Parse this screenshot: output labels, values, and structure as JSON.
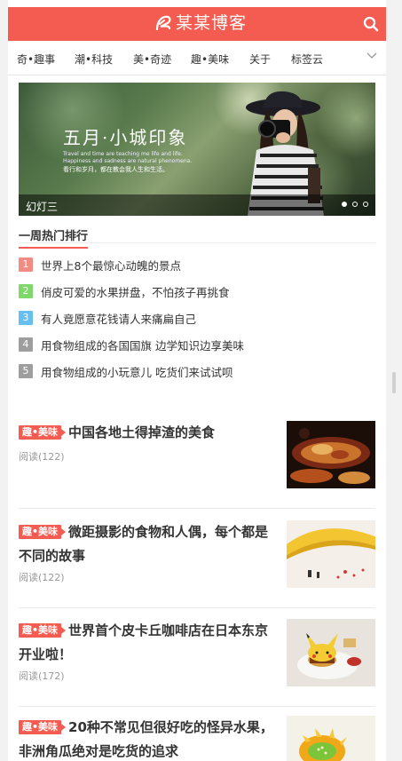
{
  "header": {
    "site_name": "某某博客",
    "brand_color": "#f45c52"
  },
  "nav": {
    "items": [
      "奇•趣事",
      "潮•科技",
      "美•奇迹",
      "趣•美味",
      "关于",
      "标签云"
    ]
  },
  "slider": {
    "headline": "五月·小城印象",
    "sub1": "Travel and time are teaching me life and life.",
    "sub2": "Happiness and sadness are natural phenomena.",
    "sub3": "看行和岁月，都在教会我人生和生活。",
    "caption": "幻灯三",
    "slides_total": 3,
    "active_slide": 1
  },
  "hot": {
    "title": "一周热门排行",
    "items": [
      {
        "rank": "1",
        "text": "世界上8个最惊心动魄的景点",
        "color": "#f28b82"
      },
      {
        "rank": "2",
        "text": "俏皮可爱的水果拼盘，不怕孩子再挑食",
        "color": "#7ed86a"
      },
      {
        "rank": "3",
        "text": "有人竟愿意花钱请人来痛扁自己",
        "color": "#66bff0"
      },
      {
        "rank": "4",
        "text": "用食物组成的各国国旗 边学知识边享美味",
        "color": "#9e9e9e"
      },
      {
        "rank": "5",
        "text": "用食物组成的小玩意儿 吃货们来试试呗",
        "color": "#9e9e9e"
      }
    ]
  },
  "articles": [
    {
      "tag": "趣•美味",
      "title": "中国各地土得掉渣的美食",
      "meta": "阅读(122)"
    },
    {
      "tag": "趣•美味",
      "title": "微距摄影的食物和人偶，每个都是不同的故事",
      "meta": "阅读(122)"
    },
    {
      "tag": "趣•美味",
      "title": "世界首个皮卡丘咖啡店在日本东京开业啦！",
      "meta": "阅读(172)"
    },
    {
      "tag": "趣•美味",
      "title": "20种不常见但很好吃的怪异水果，非洲角瓜绝对是吃货的追求",
      "meta": ""
    }
  ]
}
